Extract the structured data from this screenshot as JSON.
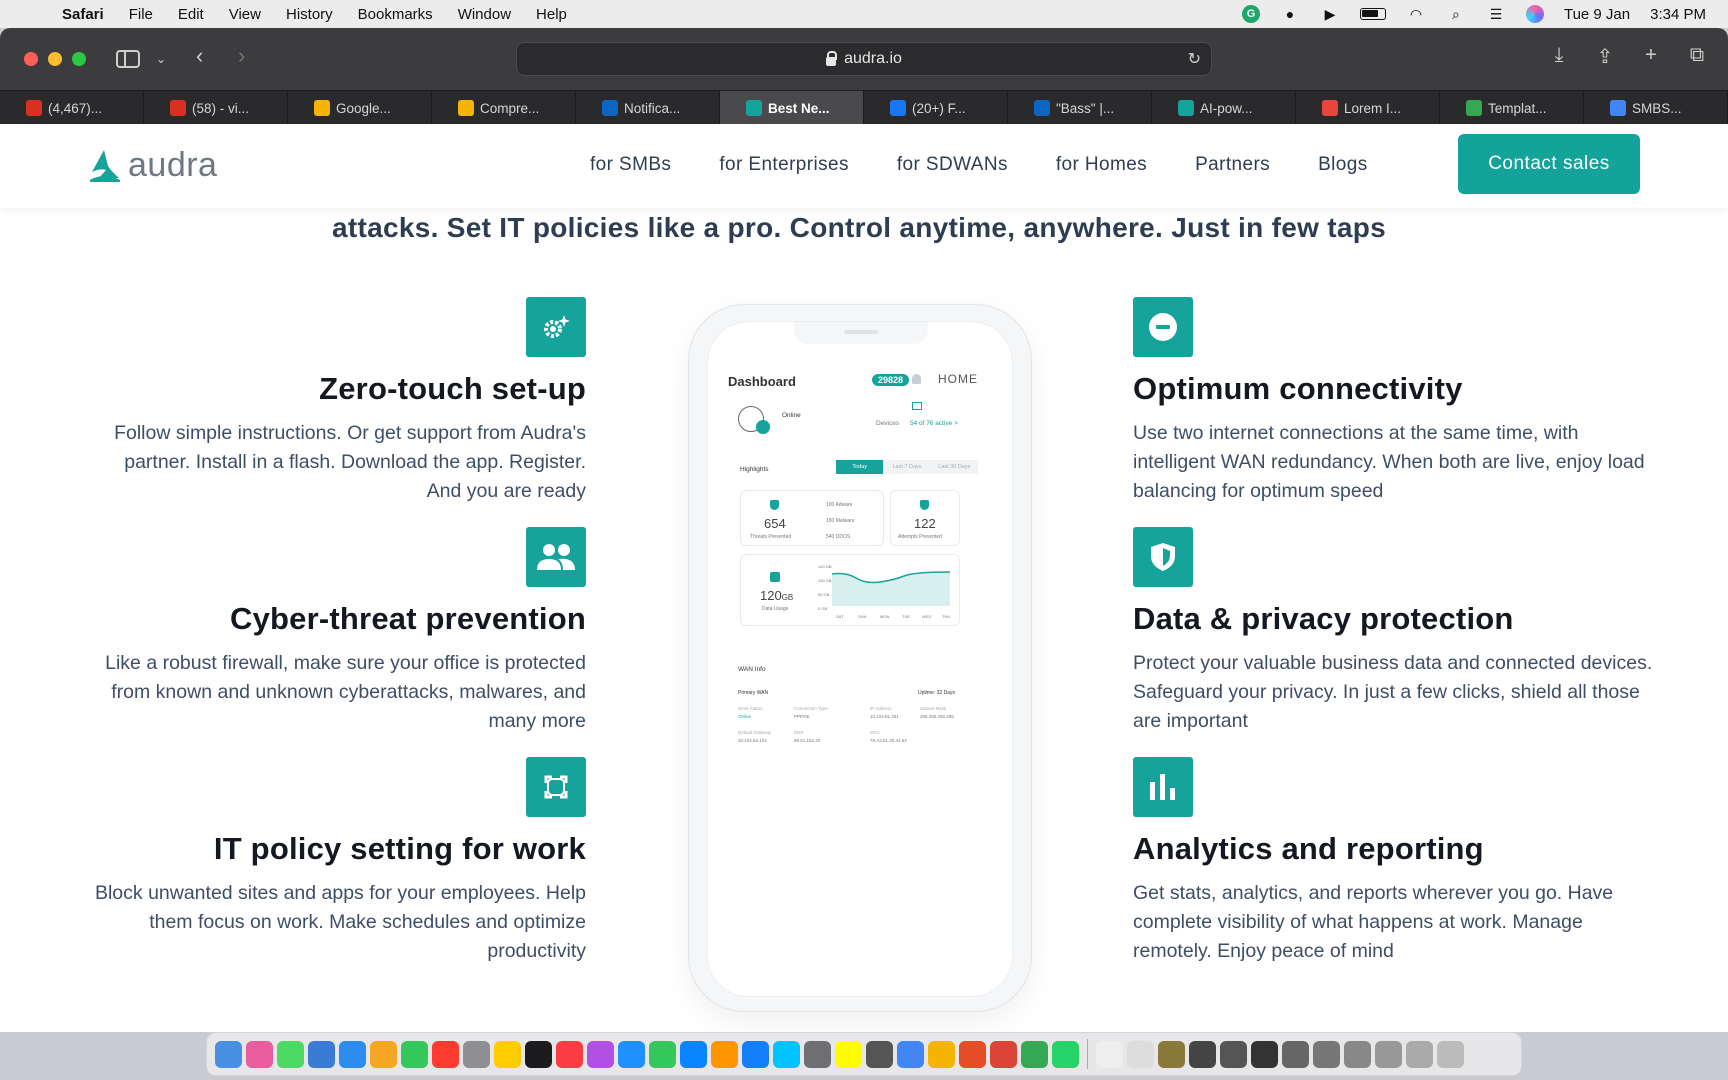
{
  "menubar": {
    "app": "Safari",
    "items": [
      "File",
      "Edit",
      "View",
      "History",
      "Bookmarks",
      "Window",
      "Help"
    ],
    "date": "Tue 9 Jan",
    "time": "3:34 PM"
  },
  "browser": {
    "url": "audra.io",
    "tabs": [
      {
        "label": "(4,467)...",
        "color": "#d93025"
      },
      {
        "label": "(58) - vi...",
        "color": "#d93025"
      },
      {
        "label": "Google...",
        "color": "#f4b400"
      },
      {
        "label": "Compre...",
        "color": "#f4b400"
      },
      {
        "label": "Notifica...",
        "color": "#0a66c2"
      },
      {
        "label": "Best Ne...",
        "color": "#15a39b",
        "active": true
      },
      {
        "label": "(20+) F...",
        "color": "#1877f2"
      },
      {
        "label": "\"Bass\" |...",
        "color": "#0a66c2"
      },
      {
        "label": "AI-pow...",
        "color": "#15a39b"
      },
      {
        "label": "Lorem I...",
        "color": "#e8453c"
      },
      {
        "label": "Templat...",
        "color": "#34a853"
      },
      {
        "label": "SMBS...",
        "color": "#4285f4"
      }
    ]
  },
  "site": {
    "logo": "audra",
    "nav": [
      "for SMBs",
      "for Enterprises",
      "for SDWANs",
      "for Homes",
      "Partners",
      "Blogs"
    ],
    "cta": "Contact sales",
    "accent": "#15a39b",
    "hero_line": "attacks. Set IT policies like a pro. Control anytime, anywhere. Just in few taps"
  },
  "features_left": [
    {
      "icon": "gear-sparkle-icon",
      "title": "Zero-touch set-up",
      "desc": "Follow simple instructions. Or get support from Audra's partner. Install in a flash. Download the app. Register. And you are ready"
    },
    {
      "icon": "users-icon",
      "title": "Cyber-threat prevention",
      "desc": "Like a robust firewall, make sure your office is protected from known and unknown cyberattacks, malwares, and many more"
    },
    {
      "icon": "focus-frame-icon",
      "title": "IT policy setting for work",
      "desc": "Block unwanted sites and apps for your employees. Help them focus on work. Make schedules and optimize productivity"
    }
  ],
  "features_right": [
    {
      "icon": "minus-circle-icon",
      "title": "Optimum connectivity",
      "desc": "Use two internet connections at the same time, with intelligent WAN redundancy. When both are live, enjoy load balancing for optimum speed"
    },
    {
      "icon": "shield-icon",
      "title": "Data & privacy protection",
      "desc": "Protect your valuable business data and connected devices. Safeguard your privacy. In just a few clicks, shield all those are important"
    },
    {
      "icon": "bar-chart-icon",
      "title": "Analytics and reporting",
      "desc": "Get stats, analytics, and reports wherever you go. Have complete visibility of what happens at work. Manage remotely. Enjoy peace of mind"
    }
  ],
  "phone": {
    "title": "Dashboard",
    "badge": "29828",
    "home": "HOME",
    "status": "Online",
    "devices_label": "Devices",
    "devices_value": "54 of 76 active >",
    "highlights": "Highlights",
    "periods": [
      "Today",
      "Last 7 Days",
      "Last 30 Days"
    ],
    "threats_num": "654",
    "threats_label": "Threats Prevented",
    "list": [
      "100 Adware",
      "150 Malware",
      "540 DDOS"
    ],
    "attempts_num": "122",
    "attempts_label": "Attempts Prevented",
    "usage_num": "120",
    "usage_unit": "GB",
    "usage_label": "Data Usage",
    "y_ticks": [
      "120 GB",
      "100 GB",
      "50 GB",
      "0 GB"
    ],
    "days": [
      "SAT",
      "SUN",
      "MON",
      "TUE",
      "WED",
      "THU"
    ],
    "wan_info": "WAN Info",
    "primary_wan": "Primary WAN",
    "uptime": "Uptime: 32 Days",
    "wan_status_label": "WAN Status",
    "wan_status_value": "Online",
    "conn_type_label": "Connection Type",
    "conn_type_value": "PPPOE",
    "ip_label": "IP Address",
    "ip_value": "10.104.81.251",
    "subnet_label": "Subnet Mask",
    "subnet_value": "255.255.255.255",
    "gateway_label": "Default Gateway",
    "gateway_value": "10.104.64.104",
    "dns_label": "DNS",
    "dns_value": "58.51.152.22",
    "mac_label": "MAC",
    "mac_value": "78.A3.51.20.41.64"
  },
  "dock_colors": [
    "#4a90e2",
    "#e85d9e",
    "#4cd964",
    "#3a7bd5",
    "#2d8cf0",
    "#f5a623",
    "#34c759",
    "#ff3b30",
    "#8e8e93",
    "#ffcc00",
    "#1c1c1e",
    "#fc3c44",
    "#b150e2",
    "#1e90ff",
    "#34c759",
    "#0a84ff",
    "#ff9500",
    "#147efb",
    "#00c3ff",
    "#6e6e73",
    "#fffc00",
    "#555",
    "#4285f4",
    "#f4b400",
    "#e44d26",
    "#db4437",
    "#34a853",
    "#25d366",
    "#eee",
    "#ddd",
    "#8a7a3a",
    "#444",
    "#555",
    "#333",
    "#666",
    "#777",
    "#888",
    "#999",
    "#aaa",
    "#bbb"
  ]
}
